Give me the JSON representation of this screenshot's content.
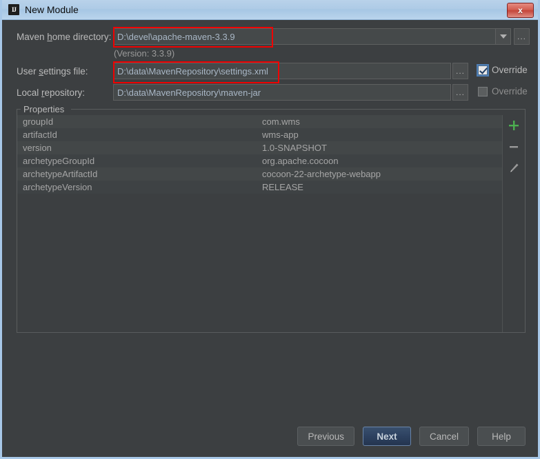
{
  "window": {
    "title": "New Module",
    "logo_text": "IJ",
    "close_label": "x"
  },
  "form": {
    "maven_home": {
      "label_pre": "Maven ",
      "label_mnemonic": "h",
      "label_post": "ome directory:",
      "value": "D:\\devel\\apache-maven-3.3.9",
      "dropdown_icon": "chevron-down-icon",
      "browse_label": "..."
    },
    "version_note": "(Version: 3.3.9)",
    "user_settings": {
      "label_pre": "User ",
      "label_mnemonic": "s",
      "label_post": "ettings file:",
      "value": "D:\\data\\MavenRepository\\settings.xml",
      "browse_label": "...",
      "override_label": "Override",
      "override_checked": true
    },
    "local_repository": {
      "label_pre": "Local ",
      "label_mnemonic": "r",
      "label_post": "epository:",
      "value": "D:\\data\\MavenRepository\\maven-jar",
      "browse_label": "...",
      "override_label": "Override",
      "override_checked": false
    }
  },
  "properties": {
    "legend": "Properties",
    "rows": [
      {
        "key": "groupId",
        "value": "com.wms"
      },
      {
        "key": "artifactId",
        "value": "wms-app"
      },
      {
        "key": "version",
        "value": "1.0-SNAPSHOT"
      },
      {
        "key": "archetypeGroupId",
        "value": "org.apache.cocoon"
      },
      {
        "key": "archetypeArtifactId",
        "value": "cocoon-22-archetype-webapp"
      },
      {
        "key": "archetypeVersion",
        "value": "RELEASE"
      }
    ],
    "toolbar": {
      "add_icon": "plus-icon",
      "remove_icon": "minus-icon",
      "edit_icon": "pencil-icon",
      "add_color": "#4caf50",
      "remove_color": "#9a9a9a",
      "edit_color": "#9a9a9a"
    }
  },
  "footer": {
    "previous": "Previous",
    "next": "Next",
    "cancel": "Cancel",
    "help": "Help"
  },
  "annotation_color": "#f00000"
}
